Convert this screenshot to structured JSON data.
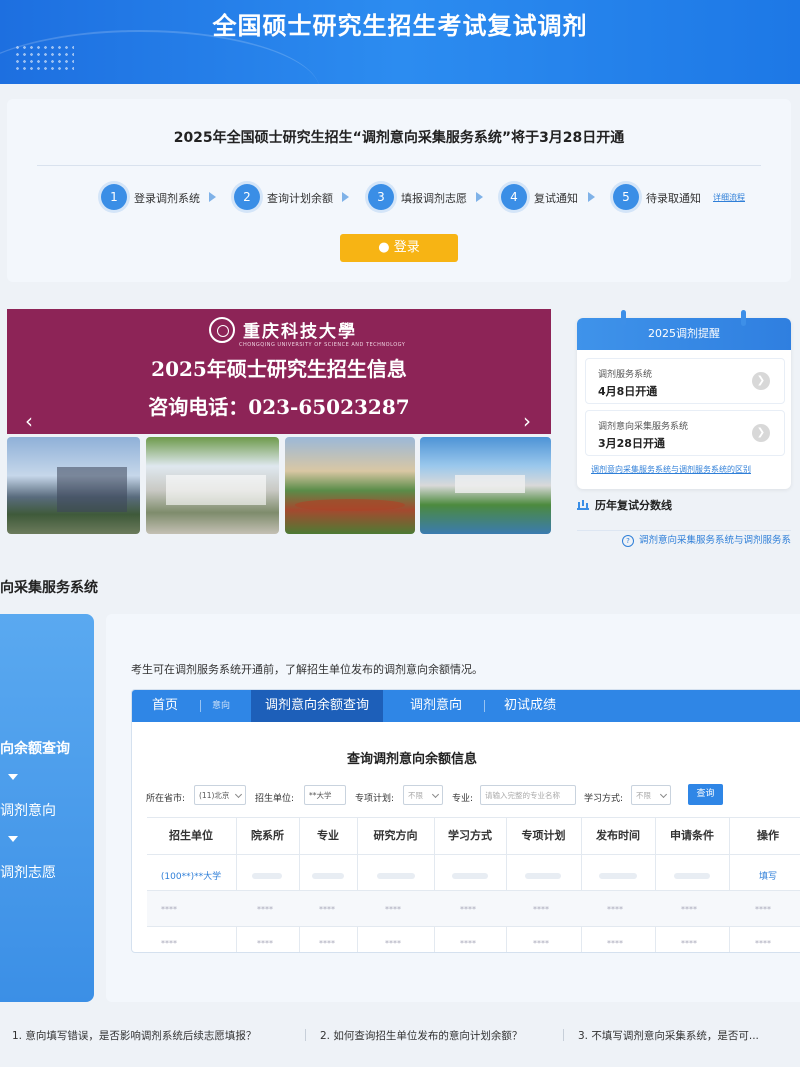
{
  "header": {
    "title": "全国硕士研究生招生考试复试调剂"
  },
  "notice": {
    "title": "2025年全国硕士研究生招生“调剂意向采集服务系统”将于3月28日开通",
    "steps": [
      {
        "num": "1",
        "label": "登录调剂系统"
      },
      {
        "num": "2",
        "label": "查询计划余额"
      },
      {
        "num": "3",
        "label": "填报调剂志愿"
      },
      {
        "num": "4",
        "label": "复试通知"
      },
      {
        "num": "5",
        "label": "待录取通知"
      }
    ],
    "detail_link": "详细流程",
    "login_label": "登录"
  },
  "banner": {
    "university": "重庆科技大學",
    "university_en": "CHONGQING UNIVERSITY OF SCIENCE AND TECHNOLOGY",
    "line1": "2025年硕士研究生招生信息",
    "line2": "咨询电话：023-65023287"
  },
  "reminder": {
    "title": "2025调剂提醒",
    "cards": [
      {
        "name": "调剂服务系统",
        "date": "4月8日开通"
      },
      {
        "name": "调剂意向采集服务系统",
        "date": "3月28日开通"
      }
    ],
    "link": "调剂意向采集服务系统与调剂服务系统的区别",
    "history": "历年复试分数线",
    "faq_link": "调剂意向采集服务系统与调剂服务系"
  },
  "section": {
    "title": "向采集服务系统"
  },
  "left_menu": {
    "items": [
      "向余额查询",
      "调剂意向",
      "调剂志愿"
    ]
  },
  "main": {
    "intro": "考生可在调剂服务系统开通前，了解招生单位发布的调剂意向余额情况。",
    "tabs": [
      "首页",
      "意向",
      "调剂意向余额查询",
      "调剂意向",
      "初试成绩"
    ],
    "query_title": "查询调剂意向余额信息",
    "filters": {
      "province_label": "所在省市:",
      "province_value": "(11)北京",
      "unit_label": "招生单位:",
      "unit_value": "**大学",
      "plan_label": "专项计划:",
      "plan_value": "不限",
      "major_label": "专业:",
      "major_placeholder": "请输入完整的专业名称",
      "mode_label": "学习方式:",
      "mode_value": "不限",
      "query_btn": "查询"
    },
    "columns": [
      "招生单位",
      "院系所",
      "专业",
      "研究方向",
      "学习方式",
      "专项计划",
      "发布时间",
      "申请条件",
      "操作"
    ],
    "first_row_unit": "(100**)**大学",
    "fill_action": "填写",
    "masked": "****"
  },
  "footer": {
    "faqs": [
      "1. 意向填写错误，是否影响调剂系统后续志愿填报？",
      "2. 如何查询招生单位发布的意向计划余额？",
      "3. 不填写调剂意向采集系统，是否可..."
    ]
  },
  "colors": {
    "primary": "#2f86e6",
    "accent": "#f7b414",
    "banner": "#8d2457"
  }
}
